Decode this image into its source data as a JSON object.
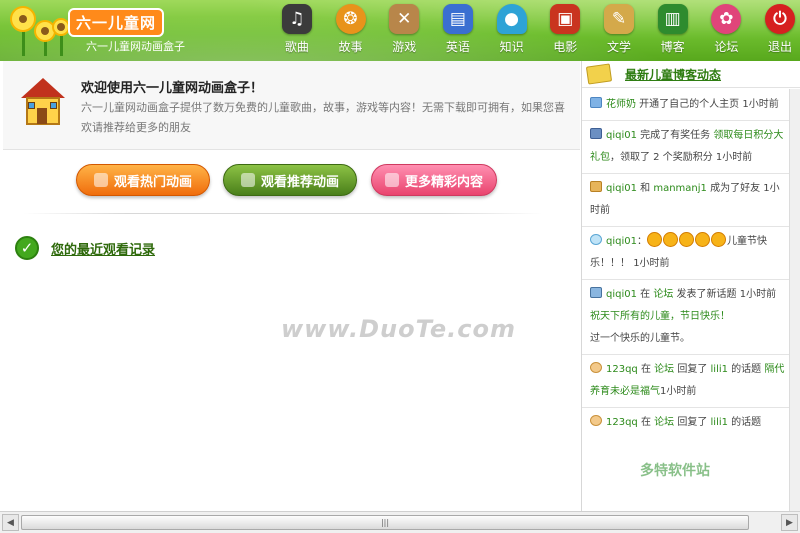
{
  "header": {
    "brand": "六一儿童网",
    "subtitle": "六一儿童网动画盒子",
    "nav": [
      {
        "label": "歌曲",
        "icon": "music-icon",
        "color": "#3b3b3b"
      },
      {
        "label": "故事",
        "icon": "lion-icon",
        "color": "#e8931b"
      },
      {
        "label": "游戏",
        "icon": "swords-icon",
        "color": "#b8864a"
      },
      {
        "label": "英语",
        "icon": "books-icon",
        "color": "#3a6fd1"
      },
      {
        "label": "知识",
        "icon": "mushroom-icon",
        "color": "#2ea3d6"
      },
      {
        "label": "电影",
        "icon": "tv-icon",
        "color": "#c9341f"
      },
      {
        "label": "文学",
        "icon": "scroll-icon",
        "color": "#d4a94a"
      },
      {
        "label": "博客",
        "icon": "book-icon",
        "color": "#2e8b2e"
      },
      {
        "label": "论坛",
        "icon": "flower-icon",
        "color": "#e0457a"
      },
      {
        "label": "退出",
        "icon": "power-icon",
        "color": "#d62020"
      }
    ]
  },
  "welcome": {
    "title": "欢迎使用六一儿童网动画盒子！",
    "desc": "六一儿童网动画盒子提供了数万免费的儿童歌曲，故事，游戏等内容！无需下载即可拥有，如果您喜欢请推荐给更多的朋友"
  },
  "buttons": {
    "hot": "观看热门动画",
    "recommended": "观看推荐动画",
    "more": "更多精彩内容"
  },
  "recent": {
    "label": "您的最近观看记录"
  },
  "watermark": "www.DuoTe.com",
  "sidebar": {
    "title": "最新儿童博客动态",
    "feed": [
      {
        "user": "花师奶",
        "text": " 开通了自己的个人主页 ",
        "time": "1小时前"
      },
      {
        "user": "qiqi01",
        "text": " 完成了有奖任务 ",
        "link": "领取每日积分大礼包",
        "text2": "，领取了 2 个奖励积分 ",
        "time": "1小时前"
      },
      {
        "user": "qiqi01",
        "text": " 和 ",
        "link": "manmanj1",
        "text2": " 成为了好友 ",
        "time": "1小时前"
      },
      {
        "user": "qiqi01",
        "text": "：",
        "text2": "儿童节快乐！！！ ",
        "time": "1小时前"
      },
      {
        "user": "qiqi01",
        "text": " 在 ",
        "link": "论坛",
        "text2": " 发表了新话题 ",
        "time": "1小时前",
        "post_title": "祝天下所有的儿童，节日快乐！",
        "post_body": "过一个快乐的儿童节。"
      },
      {
        "user": "123qq",
        "text": " 在 ",
        "link": "论坛",
        "text2": " 回复了 ",
        "link2": "lili1",
        "text3": " 的话题 ",
        "topic": "隔代养育未必是福气",
        "time": "1小时前"
      },
      {
        "user": "123qq",
        "text": " 在 ",
        "link": "论坛",
        "text2": " 回复了 ",
        "link2": "lili1",
        "text3": " 的话题"
      }
    ]
  },
  "sidebar_watermark": "多特软件站"
}
